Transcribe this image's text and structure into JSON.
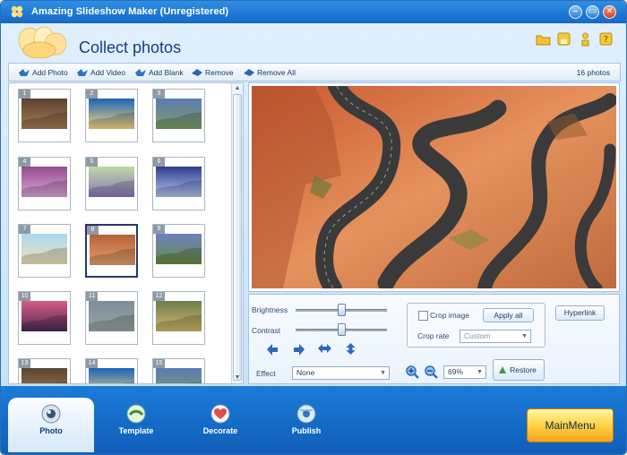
{
  "app": {
    "title": "Amazing Slideshow Maker (Unregistered)"
  },
  "window_controls": {
    "minimize": "–",
    "restore": "▭",
    "close": "×"
  },
  "header": {
    "title": "Collect photos",
    "icons": [
      "folder-icon",
      "save-icon",
      "help-person-icon",
      "question-icon"
    ]
  },
  "toolbar": {
    "add_photo": "Add Photo",
    "add_video": "Add Video",
    "add_blank": "Add Blank",
    "remove": "Remove",
    "remove_all": "Remove All",
    "photo_count": "16 photos"
  },
  "photos": [
    {
      "number": "1"
    },
    {
      "number": "2"
    },
    {
      "number": "3"
    },
    {
      "number": "4"
    },
    {
      "number": "5"
    },
    {
      "number": "6"
    },
    {
      "number": "7"
    },
    {
      "number": "8",
      "selected": true
    },
    {
      "number": "9"
    },
    {
      "number": "10"
    },
    {
      "number": "11"
    },
    {
      "number": "12"
    },
    {
      "number": "13"
    },
    {
      "number": "14"
    },
    {
      "number": "15"
    }
  ],
  "controls": {
    "brightness_label": "Brightness",
    "contrast_label": "Contrast",
    "effect_label": "Effect",
    "effect_value": "None",
    "crop_image_label": "Crop image",
    "apply_all": "Apply all",
    "crop_rate_label": "Crop rate",
    "crop_rate_value": "Custom",
    "hyperlink": "Hyperlink",
    "zoom_value": "69%",
    "restore": "Restore"
  },
  "nav": {
    "photo": "Photo",
    "template": "Template",
    "decorate": "Decorate",
    "publish": "Publish",
    "main_menu": "MainMenu"
  }
}
